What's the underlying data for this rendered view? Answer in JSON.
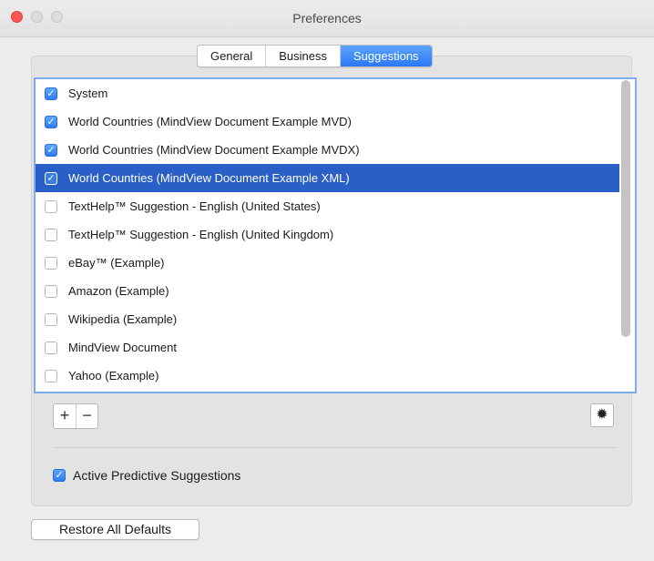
{
  "window": {
    "title": "Preferences"
  },
  "tabs": [
    {
      "label": "General",
      "active": false
    },
    {
      "label": "Business",
      "active": false
    },
    {
      "label": "Suggestions",
      "active": true
    }
  ],
  "suggestions": [
    {
      "label": "System",
      "checked": true,
      "selected": false
    },
    {
      "label": "World Countries (MindView Document Example MVD)",
      "checked": true,
      "selected": false
    },
    {
      "label": "World Countries (MindView Document Example MVDX)",
      "checked": true,
      "selected": false
    },
    {
      "label": "World Countries (MindView Document Example XML)",
      "checked": true,
      "selected": true
    },
    {
      "label": "TextHelp™ Suggestion - English (United States)",
      "checked": false,
      "selected": false
    },
    {
      "label": "TextHelp™ Suggestion - English (United Kingdom)",
      "checked": false,
      "selected": false
    },
    {
      "label": "eBay™ (Example)",
      "checked": false,
      "selected": false
    },
    {
      "label": "Amazon (Example)",
      "checked": false,
      "selected": false
    },
    {
      "label": "Wikipedia (Example)",
      "checked": false,
      "selected": false
    },
    {
      "label": "MindView Document",
      "checked": false,
      "selected": false
    },
    {
      "label": "Yahoo (Example)",
      "checked": false,
      "selected": false
    }
  ],
  "list_controls": {
    "add_icon": "plus-icon",
    "add_glyph": "+",
    "remove_icon": "minus-icon",
    "remove_glyph": "−",
    "gear_icon": "gear-icon",
    "gear_glyph": "✹"
  },
  "active_predictive": {
    "label": "Active Predictive Suggestions",
    "checked": true
  },
  "restore_button": {
    "label": "Restore All Defaults"
  },
  "colors": {
    "accent": "#2c78f4",
    "selection": "#2a5fc7",
    "close": "#fc5753"
  }
}
